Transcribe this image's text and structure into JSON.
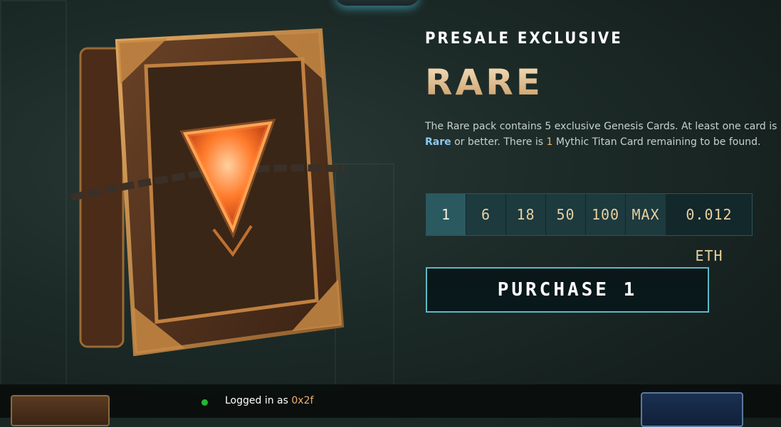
{
  "panel": {
    "eyebrow": "PRESALE EXCLUSIVE",
    "title": "RARE",
    "description": {
      "part1": "The Rare pack contains 5 exclusive Genesis Cards. At least one card is ",
      "rarity": "Rare",
      "part2": " or better. There is ",
      "count": "1",
      "part3": " Mythic Titan Card remaining to be found."
    }
  },
  "quantity": {
    "options": [
      "1",
      "6",
      "18",
      "50",
      "100",
      "MAX"
    ],
    "selected": "1",
    "price": "0.012 ETH"
  },
  "purchase_label": "PURCHASE 1",
  "status": {
    "prefix": "Logged in as ",
    "address": "0x2f",
    "dot_color": "#23b830"
  },
  "colors": {
    "accent": "#5fb8c4",
    "gem": "#ff7a2a",
    "title_gold": "#e8c99a"
  }
}
